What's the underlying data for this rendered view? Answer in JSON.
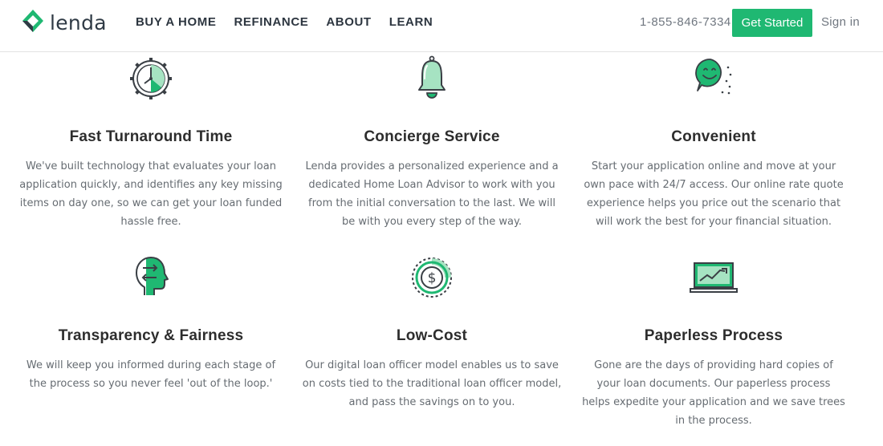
{
  "nav": {
    "logo_text": "lenda",
    "links": [
      "BUY A HOME",
      "REFINANCE",
      "ABOUT",
      "LEARN"
    ],
    "phone": "1-855-846-7334",
    "cta_label": "Get Started",
    "signin_label": "Sign in"
  },
  "colors": {
    "brand_green": "#1fb872",
    "icon_light_green": "#a6e3c2",
    "text_dark": "#2d2d2d",
    "text_body": "#666c72"
  },
  "features": [
    {
      "icon": "clock-gear-icon",
      "title": "Fast Turnaround Time",
      "body": "We've built technology that evaluates your loan application quickly, and identifies any key missing items on day one, so we can get your loan funded hassle free."
    },
    {
      "icon": "bell-icon",
      "title": "Concierge Service",
      "body": "Lenda provides a personalized experience and a dedicated Home Loan Advisor to work with you from the initial conversation to the last. We will be with you every step of the way."
    },
    {
      "icon": "smiley-icon",
      "title": "Convenient",
      "body": "Start your application online and move at your own pace with 24/7 access. Our online rate quote experience helps you price out the scenario that will work the best for your financial situation."
    },
    {
      "icon": "head-arrows-icon",
      "title": "Transparency & Fairness",
      "body": "We will keep you informed during each stage of the process so you never feel 'out of the loop.'"
    },
    {
      "icon": "dollar-coin-icon",
      "title": "Low-Cost",
      "body": "Our digital loan officer model enables us to save on costs tied to the traditional loan officer model, and pass the savings on to you."
    },
    {
      "icon": "laptop-chart-icon",
      "title": "Paperless Process",
      "body": "Gone are the days of providing hard copies of your loan documents. Our paperless process helps expedite your application and we save trees in the process."
    }
  ]
}
